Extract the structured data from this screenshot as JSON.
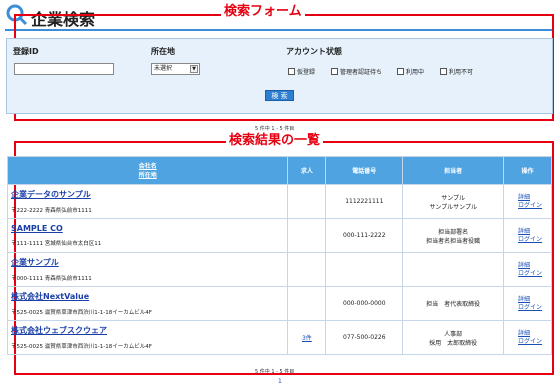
{
  "page": {
    "title": "企業検索"
  },
  "annotations": {
    "form": "検索フォーム",
    "results": "検索結果の一覧"
  },
  "search_form": {
    "id_label": "登録ID",
    "id_value": "",
    "location_label": "所在地",
    "location_selected": "未選択",
    "status_label": "アカウント状態",
    "status_options": [
      "仮登録",
      "管理者認証待ち",
      "利用中",
      "利用不可"
    ],
    "search_button": "検 索"
  },
  "result_count": "5 件中 1 - 5 件目",
  "table": {
    "headers": {
      "company": "会社名",
      "address": "所在地",
      "jobs": "求人",
      "phone": "電話番号",
      "contact": "担当者",
      "action": "操作"
    },
    "rows": [
      {
        "name": "企業データのサンプル",
        "address": "〒222-2222 青森県弘前市1111",
        "jobs": "",
        "phone": "1112221111",
        "contact_1": "サンプル",
        "contact_2": "サンプルサンプル",
        "op_1": "詳細",
        "op_2": "ログイン"
      },
      {
        "name": "SAMPLE CO",
        "address": "〒111-1111 宮城県仙台市太白区11",
        "jobs": "",
        "phone": "000-111-2222",
        "contact_1": "担当部署名",
        "contact_2": "担当者名担当者役職",
        "op_1": "詳細",
        "op_2": "ログイン"
      },
      {
        "name": "企業サンプル",
        "address": "〒000-1111 青森県弘前市1111",
        "jobs": "",
        "phone": "",
        "contact_1": "",
        "contact_2": "",
        "op_1": "詳細",
        "op_2": "ログイン"
      },
      {
        "name": "株式会社NextValue",
        "address": "〒525-0025 滋賀県草津市西渋川1-1-18イーカムビル4F",
        "jobs": "",
        "phone": "000-000-0000",
        "contact_1": "",
        "contact_2": "担当　者代表取締役",
        "op_1": "詳細",
        "op_2": "ログイン"
      },
      {
        "name": "株式会社ウェブスクウェア",
        "address": "〒525-0025 滋賀県草津市西渋川1-1-18イーカムビル4F",
        "jobs": "3件",
        "phone": "077-500-0226",
        "contact_1": "人事部",
        "contact_2": "採用　太郎取締役",
        "op_1": "詳細",
        "op_2": "ログイン"
      }
    ]
  },
  "pagination": {
    "current": "1"
  },
  "colors": {
    "accent": "#e60012",
    "header_blue": "#4fa3e0",
    "form_bg": "#e6f1fb"
  }
}
